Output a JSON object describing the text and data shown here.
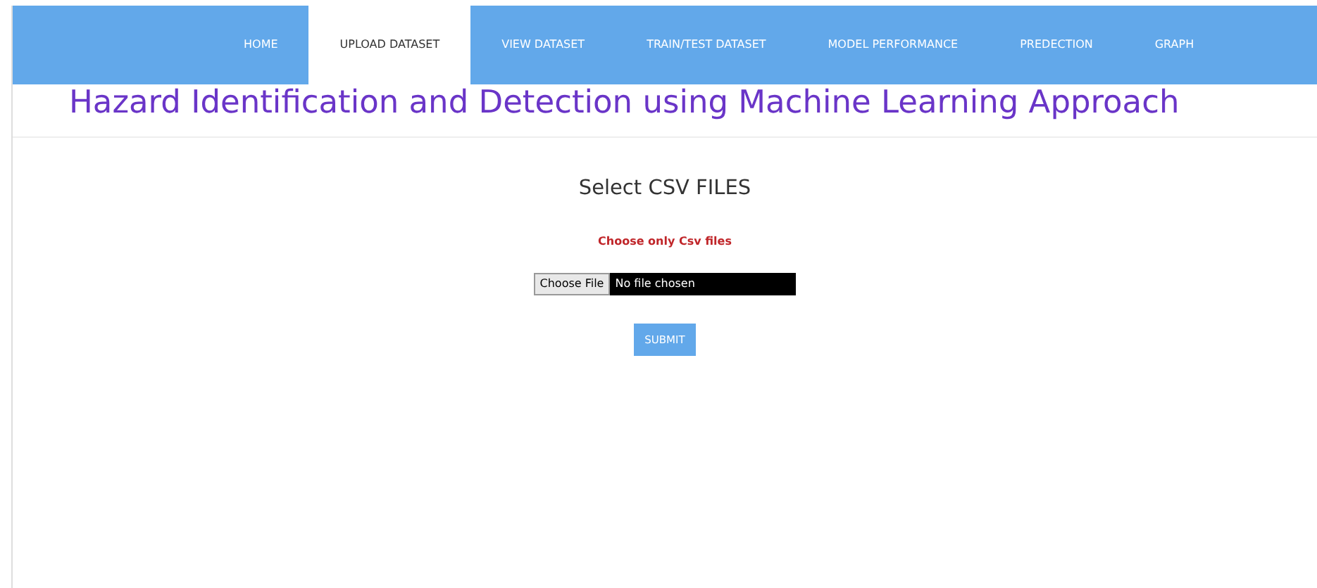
{
  "nav": {
    "items": [
      {
        "label": "HOME",
        "selected": false
      },
      {
        "label": "UPLOAD DATASET",
        "selected": true
      },
      {
        "label": "VIEW DATASET",
        "selected": false
      },
      {
        "label": "TRAIN/TEST DATASET",
        "selected": false
      },
      {
        "label": "MODEL PERFORMANCE",
        "selected": false
      },
      {
        "label": "PREDECTION",
        "selected": false
      },
      {
        "label": "GRAPH",
        "selected": false
      }
    ]
  },
  "title": "Hazard Identification and Detection using Machine Learning Approach",
  "form": {
    "heading": "Select CSV FILES",
    "note": "Choose only Csv files",
    "file_button": "Choose File",
    "file_status": "No file chosen",
    "submit": "SUBMIT"
  }
}
